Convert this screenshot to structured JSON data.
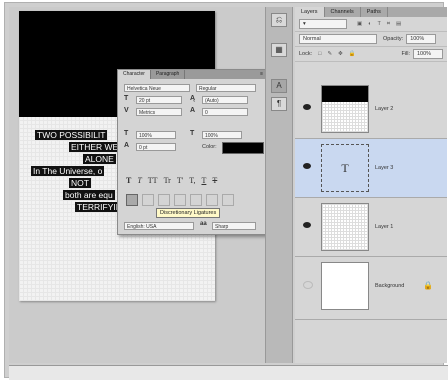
{
  "poem": [
    "TWO POSSIBILIT",
    "EITHER WE",
    "ALONE",
    "In The Universe, o",
    "NOT",
    "both are equ",
    "TERRIFYIN"
  ],
  "character_panel": {
    "tabs": [
      "Character",
      "Paragraph"
    ],
    "font_family": "Helvetica Neue",
    "font_style": "Regular",
    "font_size": "20 pt",
    "leading": "(Auto)",
    "kerning": "Metrics",
    "tracking": "0",
    "vertical_scale": "100%",
    "horizontal_scale": "100%",
    "baseline_shift": "0 pt",
    "color_label": "Color:",
    "color_value": "#000000",
    "format_buttons": [
      "T",
      "T",
      "TT",
      "Tr",
      "T'",
      "T,",
      "T",
      "T"
    ],
    "tooltip": "Discretionary Ligatures",
    "language": "English: USA",
    "antialias": "Sharp"
  },
  "layers_panel": {
    "tabs": [
      "Layers",
      "Channels",
      "Paths"
    ],
    "blend_mode": "Normal",
    "opacity_label": "Opacity:",
    "opacity": "100%",
    "lock_label": "Lock:",
    "fill_label": "Fill:",
    "fill": "100%",
    "layers": [
      {
        "name": "Layer 2",
        "selected": false,
        "visible": true
      },
      {
        "name": "Layer 3",
        "selected": true,
        "visible": true
      },
      {
        "name": "Layer 1",
        "selected": false,
        "visible": true
      },
      {
        "name": "Background",
        "selected": false,
        "visible": false
      }
    ]
  },
  "colors": {
    "selection": "#c9d8f0",
    "panel": "#d6d6d6"
  }
}
